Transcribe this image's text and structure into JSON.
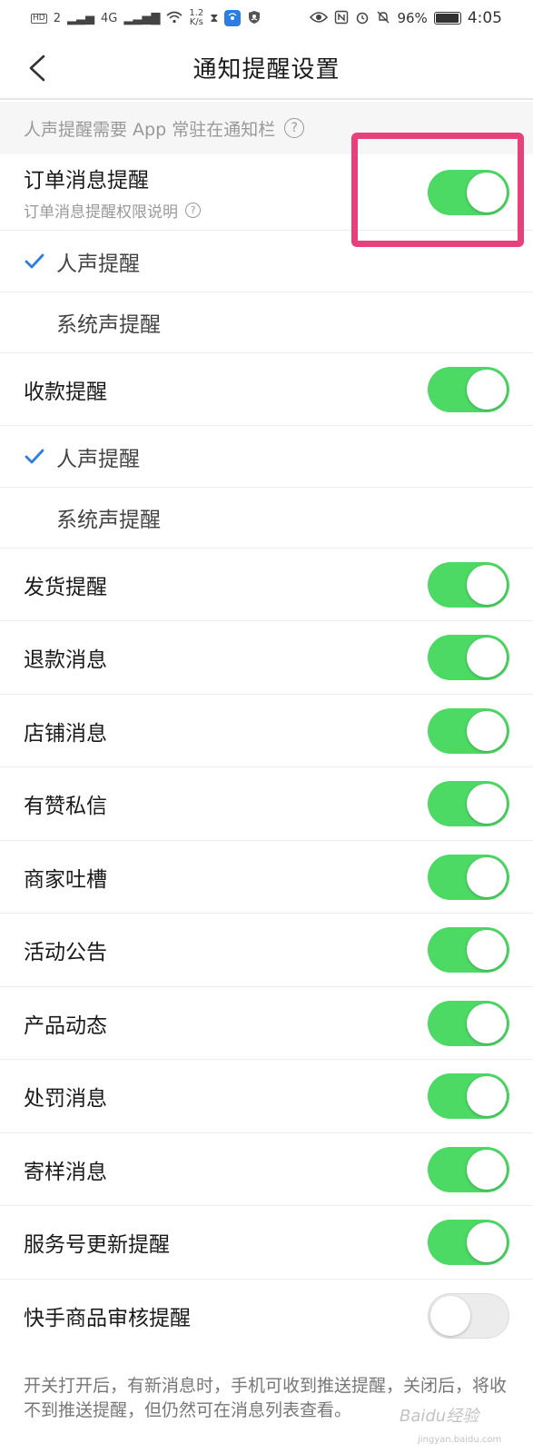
{
  "status_bar": {
    "hd": "HD",
    "sim": "2",
    "network": "4G",
    "speed_value": "1.2",
    "speed_unit": "K/s",
    "battery": "96%",
    "time": "4:05"
  },
  "nav": {
    "title": "通知提醒设置"
  },
  "hint": {
    "text": "人声提醒需要 App 常驻在通知栏",
    "help_glyph": "?"
  },
  "order_notify": {
    "label": "订单消息提醒",
    "sub": "订单消息提醒权限说明",
    "help_glyph": "?",
    "enabled": true
  },
  "order_voice_options": [
    {
      "label": "人声提醒",
      "checked": true
    },
    {
      "label": "系统声提醒",
      "checked": false
    }
  ],
  "payment_notify": {
    "label": "收款提醒",
    "enabled": true
  },
  "payment_voice_options": [
    {
      "label": "人声提醒",
      "checked": true
    },
    {
      "label": "系统声提醒",
      "checked": false
    }
  ],
  "toggles": [
    {
      "label": "发货提醒",
      "enabled": true
    },
    {
      "label": "退款消息",
      "enabled": true
    },
    {
      "label": "店铺消息",
      "enabled": true
    },
    {
      "label": "有赞私信",
      "enabled": true
    },
    {
      "label": "商家吐槽",
      "enabled": true
    },
    {
      "label": "活动公告",
      "enabled": true
    },
    {
      "label": "产品动态",
      "enabled": true
    },
    {
      "label": "处罚消息",
      "enabled": true
    },
    {
      "label": "寄样消息",
      "enabled": true
    },
    {
      "label": "服务号更新提醒",
      "enabled": true
    },
    {
      "label": "快手商品审核提醒",
      "enabled": false
    }
  ],
  "footer": {
    "note": "开关打开后，有新消息时，手机可收到推送提醒，关闭后，将收不到推送提醒，但仍然可在消息列表查看。"
  },
  "watermark": {
    "text": "Baidu经验",
    "sub": "jingyan.baidu.com"
  },
  "colors": {
    "toggle_on": "#4cd964",
    "toggle_off": "#ececec",
    "check": "#2a7de1",
    "highlight": "#e8407a"
  }
}
